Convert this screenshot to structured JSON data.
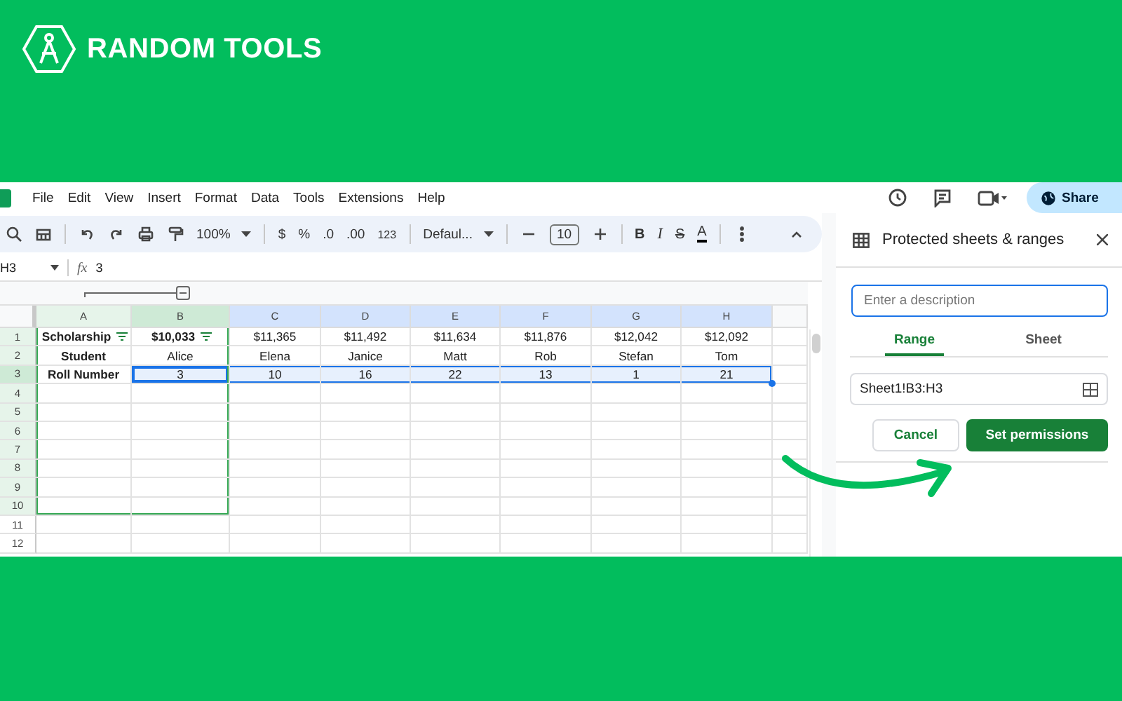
{
  "brand": {
    "name": "RANDOM TOOLS"
  },
  "menu": [
    "File",
    "Edit",
    "View",
    "Insert",
    "Format",
    "Data",
    "Tools",
    "Extensions",
    "Help"
  ],
  "share": {
    "label": "Share"
  },
  "toolbar": {
    "zoom": "100%",
    "currency": "$",
    "percent": "%",
    "decrease_decimal": ".0",
    "increase_decimal": ".00",
    "number_format": "123",
    "font": "Defaul...",
    "font_size": "10",
    "bold": "B",
    "italic": "I",
    "strikethrough": "S",
    "text_color": "A"
  },
  "formula_bar": {
    "cell": "H3",
    "fx": "fx",
    "value": "3"
  },
  "sheet": {
    "columns": [
      {
        "label": "A",
        "selected": false,
        "filtered": true
      },
      {
        "label": "B",
        "selected": true,
        "filtered": true
      },
      {
        "label": "C",
        "selected": true,
        "filtered": false
      },
      {
        "label": "D",
        "selected": true,
        "filtered": false
      },
      {
        "label": "E",
        "selected": true,
        "filtered": false
      },
      {
        "label": "F",
        "selected": true,
        "filtered": false
      },
      {
        "label": "G",
        "selected": true,
        "filtered": false
      },
      {
        "label": "H",
        "selected": true,
        "filtered": false
      }
    ],
    "rows": [
      {
        "number": "1",
        "filtered": true,
        "selected": false,
        "cells": [
          {
            "text": "Scholarship",
            "bold": true,
            "filter": true,
            "selected": false,
            "active": false
          },
          {
            "text": "$10,033",
            "bold": true,
            "filter": true,
            "selected": false,
            "active": false
          },
          {
            "text": "$11,365",
            "bold": false,
            "filter": false,
            "selected": false,
            "active": false
          },
          {
            "text": "$11,492",
            "bold": false,
            "filter": false,
            "selected": false,
            "active": false
          },
          {
            "text": "$11,634",
            "bold": false,
            "filter": false,
            "selected": false,
            "active": false
          },
          {
            "text": "$11,876",
            "bold": false,
            "filter": false,
            "selected": false,
            "active": false
          },
          {
            "text": "$12,042",
            "bold": false,
            "filter": false,
            "selected": false,
            "active": false
          },
          {
            "text": "$12,092",
            "bold": false,
            "filter": false,
            "selected": false,
            "active": false
          }
        ]
      },
      {
        "number": "2",
        "filtered": true,
        "selected": false,
        "cells": [
          {
            "text": "Student",
            "bold": true,
            "filter": false,
            "selected": false,
            "active": false
          },
          {
            "text": "Alice",
            "bold": false,
            "filter": false,
            "selected": false,
            "active": false
          },
          {
            "text": "Elena",
            "bold": false,
            "filter": false,
            "selected": false,
            "active": false
          },
          {
            "text": "Janice",
            "bold": false,
            "filter": false,
            "selected": false,
            "active": false
          },
          {
            "text": "Matt",
            "bold": false,
            "filter": false,
            "selected": false,
            "active": false
          },
          {
            "text": "Rob",
            "bold": false,
            "filter": false,
            "selected": false,
            "active": false
          },
          {
            "text": "Stefan",
            "bold": false,
            "filter": false,
            "selected": false,
            "active": false
          },
          {
            "text": "Tom",
            "bold": false,
            "filter": false,
            "selected": false,
            "active": false
          }
        ]
      },
      {
        "number": "3",
        "filtered": true,
        "selected": true,
        "cells": [
          {
            "text": "Roll Number",
            "bold": true,
            "filter": false,
            "selected": false,
            "active": false
          },
          {
            "text": "3",
            "bold": false,
            "filter": false,
            "selected": true,
            "active": true
          },
          {
            "text": "10",
            "bold": false,
            "filter": false,
            "selected": true,
            "active": false
          },
          {
            "text": "16",
            "bold": false,
            "filter": false,
            "selected": true,
            "active": false
          },
          {
            "text": "22",
            "bold": false,
            "filter": false,
            "selected": true,
            "active": false
          },
          {
            "text": "13",
            "bold": false,
            "filter": false,
            "selected": true,
            "active": false
          },
          {
            "text": "1",
            "bold": false,
            "filter": false,
            "selected": true,
            "active": false
          },
          {
            "text": "21",
            "bold": false,
            "filter": false,
            "selected": true,
            "active": false
          }
        ]
      },
      {
        "number": "4",
        "filtered": true,
        "selected": false
      },
      {
        "number": "5",
        "filtered": true,
        "selected": false
      },
      {
        "number": "6",
        "filtered": true,
        "selected": false
      },
      {
        "number": "7",
        "filtered": true,
        "selected": false
      },
      {
        "number": "8",
        "filtered": true,
        "selected": false
      },
      {
        "number": "9",
        "filtered": true,
        "selected": false
      },
      {
        "number": "10",
        "filtered": true,
        "selected": false
      },
      {
        "number": "11",
        "filtered": false,
        "selected": false
      },
      {
        "number": "12",
        "filtered": false,
        "selected": false
      }
    ]
  },
  "panel": {
    "title": "Protected sheets & ranges",
    "description": {
      "placeholder": "Enter a description"
    },
    "tabs": [
      {
        "label": "Range",
        "selected": true
      },
      {
        "label": "Sheet",
        "selected": false
      }
    ],
    "range": "Sheet1!B3:H3",
    "cancel": "Cancel",
    "confirm": "Set permissions"
  }
}
